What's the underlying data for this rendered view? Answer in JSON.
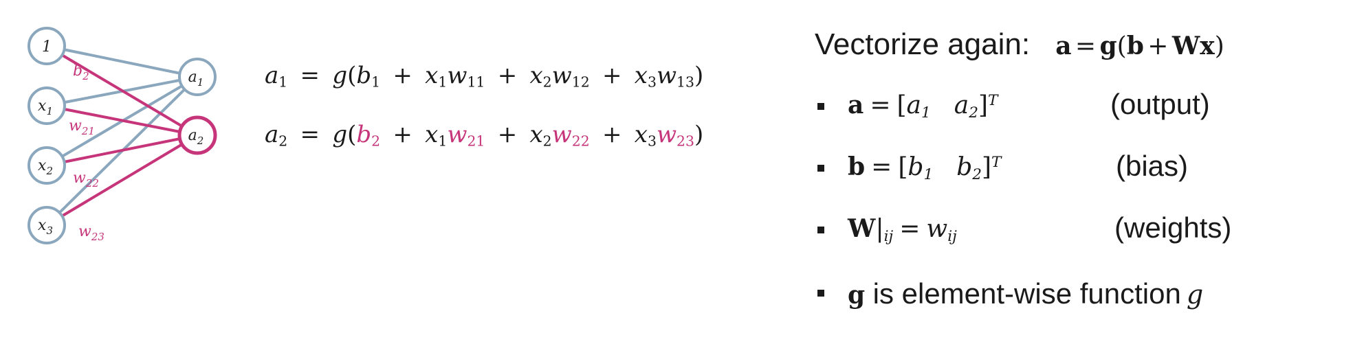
{
  "network": {
    "inputs": [
      {
        "label": "1",
        "sub": ""
      },
      {
        "label": "x",
        "sub": "1"
      },
      {
        "label": "x",
        "sub": "2"
      },
      {
        "label": "x",
        "sub": "3"
      }
    ],
    "outputs": [
      {
        "label": "a",
        "sub": "1"
      },
      {
        "label": "a",
        "sub": "2"
      }
    ],
    "weight_labels": [
      {
        "label": "b",
        "sub": "2"
      },
      {
        "label": "w",
        "sub": "21"
      },
      {
        "label": "w",
        "sub": "22"
      },
      {
        "label": "w",
        "sub": "23"
      }
    ],
    "colors": {
      "input_stroke": "#8aa7bd",
      "highlight": "#c6357a",
      "edge_blue": "#8aa7bd"
    }
  },
  "equations": {
    "eq1": {
      "lhs": "a",
      "lhs_sub": "1",
      "g": "g",
      "open": "(",
      "close": ")",
      "b": "b",
      "b_sub": "1",
      "t1x": "x",
      "t1x_sub": "1",
      "t1w": "w",
      "t1w_sub": "11",
      "t2x": "x",
      "t2x_sub": "2",
      "t2w": "w",
      "t2w_sub": "12",
      "t3x": "x",
      "t3x_sub": "3",
      "t3w": "w",
      "t3w_sub": "13"
    },
    "eq2": {
      "lhs": "a",
      "lhs_sub": "2",
      "g": "g",
      "open": "(",
      "close": ")",
      "b": "b",
      "b_sub": "2",
      "t1x": "x",
      "t1x_sub": "1",
      "t1w": "w",
      "t1w_sub": "21",
      "t2x": "x",
      "t2x_sub": "2",
      "t2w": "w",
      "t2w_sub": "22",
      "t3x": "x",
      "t3x_sub": "3",
      "t3w": "w",
      "t3w_sub": "23"
    },
    "eq_sign": "=",
    "plus": "+"
  },
  "vectorize": {
    "heading": "Vectorize again:",
    "formula": {
      "a": "a",
      "eq": "=",
      "g": "g",
      "open": "(",
      "b": "b",
      "plus": "+",
      "Wx": "Wx",
      "close": ")"
    },
    "items": [
      {
        "var": "a",
        "eq": "=",
        "open": "[",
        "e1": "a",
        "e1_sub": "1",
        "e2": "a",
        "e2_sub": "2",
        "close": "]",
        "sup": "T",
        "note": "(output)"
      },
      {
        "var": "b",
        "eq": "=",
        "open": "[",
        "e1": "b",
        "e1_sub": "1",
        "e2": "b",
        "e2_sub": "2",
        "close": "]",
        "sup": "T",
        "note": "(bias)"
      },
      {
        "var": "W",
        "bar": "|",
        "var_sub": "ij",
        "eq": "=",
        "rhs": "w",
        "rhs_sub": "ij",
        "note": "(weights)"
      }
    ],
    "g_item": {
      "var": "g",
      "text": "is element-wise function",
      "fn": "g"
    }
  }
}
